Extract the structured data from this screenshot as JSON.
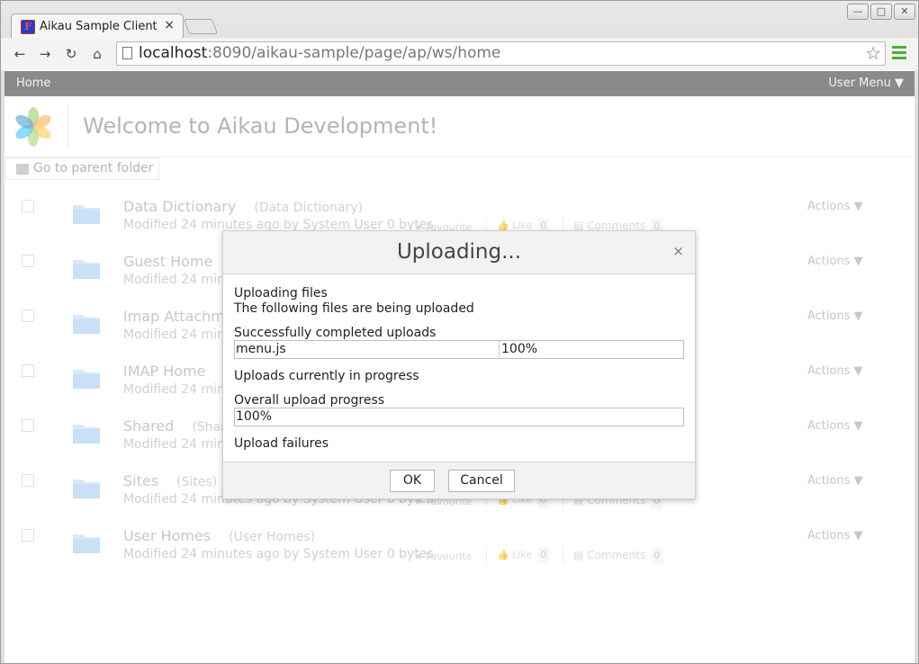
{
  "browser": {
    "tab_title": "Aikau Sample Client",
    "tab_close": "×",
    "favicon_glyph": "F",
    "url_host": "localhost",
    "url_rest": ":8090/aikau-sample/page/ap/ws/home",
    "icons": [
      "back-icon",
      "forward-icon",
      "reload-icon",
      "home-icon",
      "page-icon",
      "bookmark-star-icon",
      "menu-icon"
    ],
    "window_buttons": [
      "minimize",
      "maximize",
      "close"
    ]
  },
  "appbar": {
    "home_label": "Home",
    "user_menu_label": "User Menu ▼"
  },
  "page": {
    "title": "Welcome to Aikau Development!",
    "parent_folder_label": "Go to parent folder"
  },
  "rows": [
    {
      "name": "Data Dictionary",
      "title": "(Data Dictionary)",
      "meta": "Modified 24 minutes ago by System User 0 bytes"
    },
    {
      "name": "Guest Home",
      "title": "",
      "meta": "Modified 24 minu"
    },
    {
      "name": "Imap Attachm",
      "title": "",
      "meta": "Modified 24 minu"
    },
    {
      "name": "IMAP Home",
      "title": "",
      "meta": "Modified 24 minu"
    },
    {
      "name": "Shared",
      "title": "(Shar",
      "meta": "Modified 24 minu"
    },
    {
      "name": "Sites",
      "title": "(Sites)",
      "meta": "Modified 24 minutes ago by System User 0 bytes"
    },
    {
      "name": "User Homes",
      "title": "(User Homes)",
      "meta": "Modified 24 minutes ago by System User 0 bytes"
    }
  ],
  "row_common": {
    "favourite_label": "Favourite",
    "like_label": "Like",
    "like_count": "0",
    "comments_label": "Comments",
    "comments_count": "0",
    "actions_label": "Actions ▼"
  },
  "dialog": {
    "title": "Uploading...",
    "close": "×",
    "uploading_files": "Uploading files",
    "subtitle": "The following files are being uploaded",
    "completed_heading": "Successfully completed uploads",
    "completed_file": "menu.js",
    "completed_percent": "100%",
    "in_progress_heading": "Uploads currently in progress",
    "overall_heading": "Overall upload progress",
    "overall_percent": "100%",
    "failures_heading": "Upload failures",
    "ok_label": "OK",
    "cancel_label": "Cancel"
  },
  "colors": {
    "appbar": "#8a8a8a",
    "folder": "#9ec6ef",
    "menu_icon": "#4caf32"
  }
}
